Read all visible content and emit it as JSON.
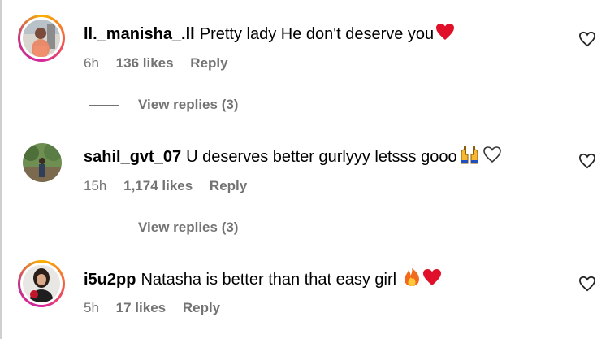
{
  "comments": [
    {
      "username": "ll._manisha_.ll",
      "text": "Pretty lady He don't deserve you",
      "emojis": [
        "red-heart"
      ],
      "time": "6h",
      "likes": "136 likes",
      "reply": "Reply",
      "view_replies": "View replies (3)",
      "avatar_ring": true
    },
    {
      "username": "sahil_gvt_07",
      "text": "U deserves better gurlyyy letsss gooo",
      "emojis": [
        "raising-hands",
        "white-heart"
      ],
      "time": "15h",
      "likes": "1,174 likes",
      "reply": "Reply",
      "view_replies": "View replies (3)",
      "avatar_ring": false
    },
    {
      "username": "i5u2pp",
      "text": "Natasha is better than that easy girl",
      "emojis": [
        "fire",
        "red-heart"
      ],
      "time": "5h",
      "likes": "17 likes",
      "reply": "Reply",
      "avatar_ring": true
    }
  ],
  "colors": {
    "meta_gray": "#737373",
    "heart_red": "#e0102a",
    "ring_gradient": [
      "#f8b400",
      "#f56040",
      "#d6249f",
      "#c13584"
    ]
  },
  "icons": {
    "like_button": "heart-outline-icon"
  }
}
